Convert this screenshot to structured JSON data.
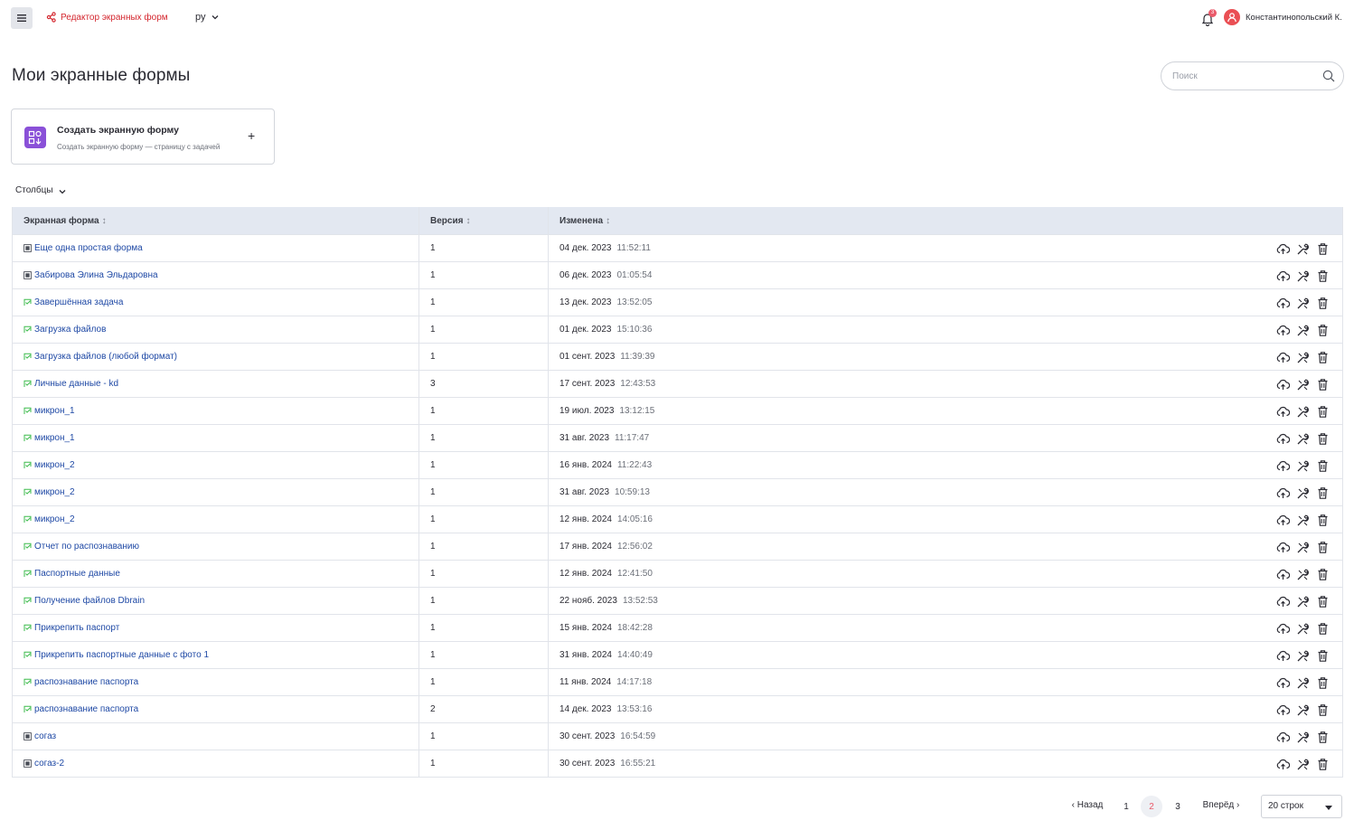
{
  "header": {
    "app_name": "Редактор экранных форм",
    "lang": "ру",
    "notifications_count": "3",
    "user_name": "Константинопольский К."
  },
  "page": {
    "title": "Мои экранные формы",
    "search_placeholder": "Поиск"
  },
  "create_card": {
    "title": "Создать экранную форму",
    "subtitle": "Создать экранную форму — страницу с задачей",
    "plus": "+"
  },
  "columns_button": "Столбцы",
  "table": {
    "headers": {
      "name": "Экранная форма",
      "version": "Версия",
      "changed": "Изменена",
      "sort_glyph": "↕"
    },
    "rows": [
      {
        "icon": "form-icon",
        "name": "Еще одна простая форма",
        "version": "1",
        "date": "04 дек. 2023",
        "time": "11:52:11"
      },
      {
        "icon": "form-icon",
        "name": "Забирова Элина Эльдаровна",
        "version": "1",
        "date": "06 дек. 2023",
        "time": "01:05:54"
      },
      {
        "icon": "task-icon",
        "name": "Завершённая задача",
        "version": "1",
        "date": "13 дек. 2023",
        "time": "13:52:05"
      },
      {
        "icon": "task-icon",
        "name": "Загрузка файлов",
        "version": "1",
        "date": "01 дек. 2023",
        "time": "15:10:36"
      },
      {
        "icon": "task-icon",
        "name": "Загрузка файлов (любой формат)",
        "version": "1",
        "date": "01 сент. 2023",
        "time": "11:39:39"
      },
      {
        "icon": "task-icon",
        "name": "Личные данные - kd",
        "version": "3",
        "date": "17 сент. 2023",
        "time": "12:43:53"
      },
      {
        "icon": "task-icon",
        "name": "микрон_1",
        "version": "1",
        "date": "19 июл. 2023",
        "time": "13:12:15"
      },
      {
        "icon": "task-icon",
        "name": "микрон_1",
        "version": "1",
        "date": "31 авг. 2023",
        "time": "11:17:47"
      },
      {
        "icon": "task-icon",
        "name": "микрон_2",
        "version": "1",
        "date": "16 янв. 2024",
        "time": "11:22:43"
      },
      {
        "icon": "task-icon",
        "name": "микрон_2",
        "version": "1",
        "date": "31 авг. 2023",
        "time": "10:59:13"
      },
      {
        "icon": "task-icon",
        "name": "микрон_2",
        "version": "1",
        "date": "12 янв. 2024",
        "time": "14:05:16"
      },
      {
        "icon": "task-icon",
        "name": "Отчет по распознаванию",
        "version": "1",
        "date": "17 янв. 2024",
        "time": "12:56:02"
      },
      {
        "icon": "task-icon",
        "name": "Паспортные данные",
        "version": "1",
        "date": "12 янв. 2024",
        "time": "12:41:50"
      },
      {
        "icon": "task-icon",
        "name": "Получение файлов Dbrain",
        "version": "1",
        "date": "22 нояб. 2023",
        "time": "13:52:53"
      },
      {
        "icon": "task-icon",
        "name": "Прикрепить паспорт",
        "version": "1",
        "date": "15 янв. 2024",
        "time": "18:42:28"
      },
      {
        "icon": "task-icon",
        "name": "Прикрепить паспортные данные с фото 1",
        "version": "1",
        "date": "31 янв. 2024",
        "time": "14:40:49"
      },
      {
        "icon": "task-icon",
        "name": "распознавание паспорта",
        "version": "1",
        "date": "11 янв. 2024",
        "time": "14:17:18"
      },
      {
        "icon": "task-icon",
        "name": "распознавание паспорта",
        "version": "2",
        "date": "14 дек. 2023",
        "time": "13:53:16"
      },
      {
        "icon": "form-icon",
        "name": "согаз",
        "version": "1",
        "date": "30 сент. 2023",
        "time": "16:54:59"
      },
      {
        "icon": "form-icon",
        "name": "согаз-2",
        "version": "1",
        "date": "30 сент. 2023",
        "time": "16:55:21"
      }
    ],
    "row_actions": [
      "publish-cloud-icon",
      "edit-tools-icon",
      "delete-trash-icon"
    ]
  },
  "pagination": {
    "prev": "‹ Назад",
    "pages": [
      "1",
      "2",
      "3"
    ],
    "current": "2",
    "next": "Вперёд ›",
    "rows_per_page": "20 строк"
  },
  "colors": {
    "brand_red": "#d4272f",
    "link_blue": "#1f49a5",
    "header_bg": "#e3e8f1",
    "accent_purple": "#8a50d8",
    "task_icon_green": "#3dbb4c"
  }
}
